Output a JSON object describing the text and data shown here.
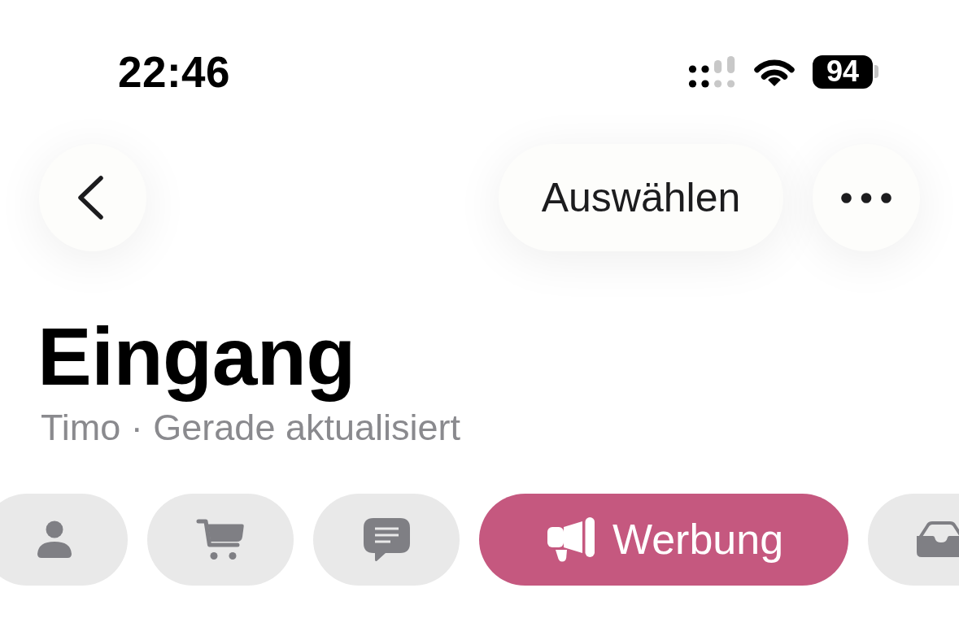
{
  "status_bar": {
    "time": "22:46",
    "battery": "94"
  },
  "nav": {
    "select_button": "Auswählen"
  },
  "header": {
    "title": "Eingang",
    "subtitle": "Timo · Gerade aktualisiert"
  },
  "categories": [
    {
      "kind": "person",
      "selected": false
    },
    {
      "kind": "cart",
      "selected": false
    },
    {
      "kind": "message",
      "selected": false
    },
    {
      "kind": "megaphone",
      "label": "Werbung",
      "selected": true
    },
    {
      "kind": "tray",
      "selected": false
    }
  ]
}
